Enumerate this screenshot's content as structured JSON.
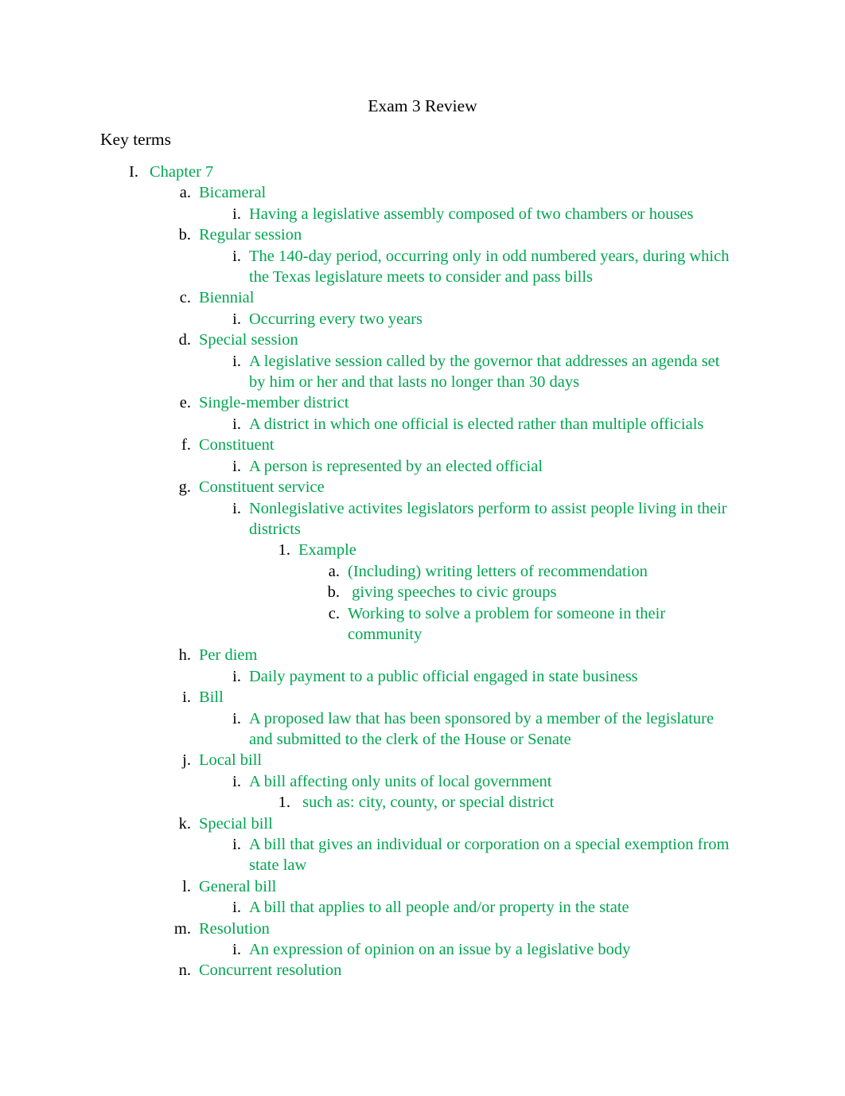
{
  "document": {
    "title": "Exam 3 Review",
    "section_heading": "Key terms",
    "text_color_accent": "#00A550",
    "text_color_default": "#000000",
    "background_color": "#FFFFFF"
  },
  "outline": [
    {
      "level": 1,
      "marker": "I.",
      "text": "Chapter 7"
    },
    {
      "level": 2,
      "marker": "a.",
      "text": "Bicameral"
    },
    {
      "level": 3,
      "marker": "i.",
      "text": "Having a legislative assembly composed of two chambers or houses"
    },
    {
      "level": 2,
      "marker": "b.",
      "text": "Regular session"
    },
    {
      "level": 3,
      "marker": "i.",
      "text": "The 140-day period, occurring only in odd numbered years, during which the Texas legislature meets to consider and pass bills"
    },
    {
      "level": 2,
      "marker": "c.",
      "text": "Biennial"
    },
    {
      "level": 3,
      "marker": "i.",
      "text": "Occurring every two years"
    },
    {
      "level": 2,
      "marker": "d.",
      "text": "Special session"
    },
    {
      "level": 3,
      "marker": "i.",
      "text": "A legislative session called by the governor that addresses an agenda set by him or her and that lasts no longer than 30 days"
    },
    {
      "level": 2,
      "marker": "e.",
      "text": "Single-member district"
    },
    {
      "level": 3,
      "marker": "i.",
      "text": "A district in which one official is elected rather than multiple officials"
    },
    {
      "level": 2,
      "marker": "f.",
      "text": "Constituent"
    },
    {
      "level": 3,
      "marker": "i.",
      "text": "A person is represented by an elected official"
    },
    {
      "level": 2,
      "marker": "g.",
      "text": "Constituent service"
    },
    {
      "level": 3,
      "marker": "i.",
      "text": "Nonlegislative activites legislators perform to assist people living in their districts"
    },
    {
      "level": 4,
      "marker": "1.",
      "text": "Example"
    },
    {
      "level": 5,
      "marker": "a.",
      "text": "(Including) writing letters of recommendation"
    },
    {
      "level": 5,
      "marker": "b.",
      "text": " giving speeches to civic groups"
    },
    {
      "level": 5,
      "marker": "c.",
      "text": "Working to solve a problem for someone in their community"
    },
    {
      "level": 2,
      "marker": "h.",
      "text": "Per diem"
    },
    {
      "level": 3,
      "marker": "i.",
      "text": "Daily payment to a public official engaged in state business"
    },
    {
      "level": 2,
      "marker": "i.",
      "text": "Bill"
    },
    {
      "level": 3,
      "marker": "i.",
      "text": "A proposed law that has been sponsored by a member of the legislature and submitted to the clerk of the House or Senate"
    },
    {
      "level": 2,
      "marker": "j.",
      "text": "Local bill"
    },
    {
      "level": 3,
      "marker": "i.",
      "text": "A bill affecting only units of local government"
    },
    {
      "level": 4,
      "marker": "1.",
      "text": " such as: city, county, or special district"
    },
    {
      "level": 2,
      "marker": "k.",
      "text": "Special bill"
    },
    {
      "level": 3,
      "marker": "i.",
      "text": "A bill that gives an individual or corporation on a special exemption from state law"
    },
    {
      "level": 2,
      "marker": "l.",
      "text": "General bill"
    },
    {
      "level": 3,
      "marker": "i.",
      "text": "A bill that applies to all people and/or property in the state"
    },
    {
      "level": 2,
      "marker": "m.",
      "text": "Resolution"
    },
    {
      "level": 3,
      "marker": "i.",
      "text": "An expression of opinion on an issue by a legislative body"
    },
    {
      "level": 2,
      "marker": "n.",
      "text": "Concurrent resolution"
    }
  ]
}
